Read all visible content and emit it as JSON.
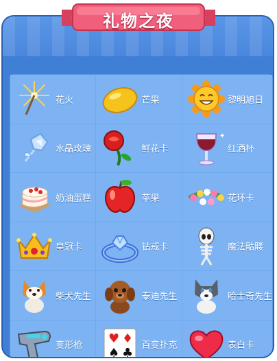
{
  "title": "礼物之夜",
  "items": [
    {
      "label": "花火",
      "icon": "firework-icon"
    },
    {
      "label": "芒果",
      "icon": "mango-icon"
    },
    {
      "label": "黎明旭日",
      "icon": "sun-icon"
    },
    {
      "label": "水晶玫瑰",
      "icon": "crystal-rose-icon"
    },
    {
      "label": "鲜花卡",
      "icon": "red-rose-icon"
    },
    {
      "label": "红酒杯",
      "icon": "wine-glass-icon"
    },
    {
      "label": "奶油蛋糕",
      "icon": "cream-cake-icon"
    },
    {
      "label": "苹果",
      "icon": "apple-icon"
    },
    {
      "label": "花环卡",
      "icon": "flower-wreath-icon"
    },
    {
      "label": "皇冠卡",
      "icon": "crown-icon"
    },
    {
      "label": "钻戒卡",
      "icon": "diamond-ring-icon"
    },
    {
      "label": "魔法骷髅",
      "icon": "skeleton-icon"
    },
    {
      "label": "柴犬先生",
      "icon": "shiba-dog-icon"
    },
    {
      "label": "泰迪先生",
      "icon": "teddy-dog-icon"
    },
    {
      "label": "哈士奇先生",
      "icon": "husky-dog-icon"
    },
    {
      "label": "变形枪",
      "icon": "transform-gun-icon"
    },
    {
      "label": "百变扑克",
      "icon": "poker-cards-icon"
    },
    {
      "label": "表白卡",
      "icon": "heart-icon"
    }
  ]
}
